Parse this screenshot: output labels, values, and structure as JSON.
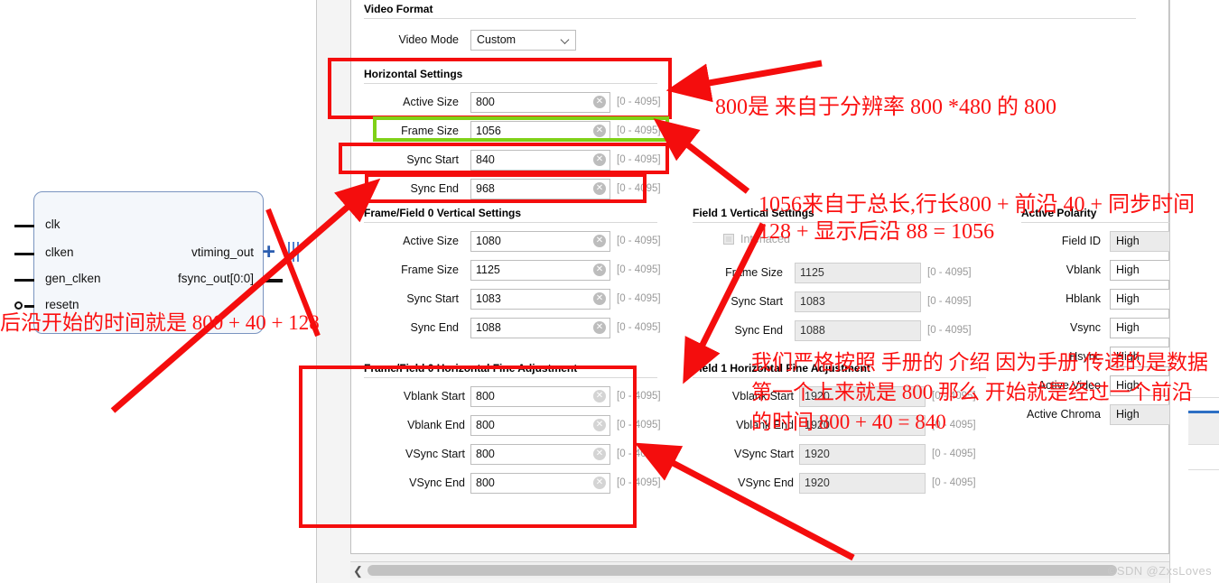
{
  "block_diagram": {
    "inputs": [
      "clk",
      "clken",
      "gen_clken",
      "resetn"
    ],
    "outputs": [
      "vtiming_out",
      "fsync_out[0:0]"
    ]
  },
  "dialog": {
    "video_format": {
      "title": "Video Format",
      "video_mode_label": "Video Mode",
      "video_mode_value": "Custom"
    },
    "horizontal_settings": {
      "title": "Horizontal Settings",
      "range": "[0 - 4095]",
      "rows": [
        {
          "label": "Active Size",
          "value": "800"
        },
        {
          "label": "Frame Size",
          "value": "1056"
        },
        {
          "label": "Sync Start",
          "value": "840"
        },
        {
          "label": "Sync End",
          "value": "968"
        }
      ]
    },
    "frame_field0_vertical": {
      "title": "Frame/Field 0 Vertical Settings",
      "range": "[0 - 4095]",
      "rows": [
        {
          "label": "Active Size",
          "value": "1080"
        },
        {
          "label": "Frame Size",
          "value": "1125"
        },
        {
          "label": "Sync Start",
          "value": "1083"
        },
        {
          "label": "Sync End",
          "value": "1088"
        }
      ]
    },
    "frame_field0_hfine": {
      "title": "Frame/Field 0 Horizontal Fine Adjustment",
      "range": "[0 - 4095]",
      "rows": [
        {
          "label": "Vblank Start",
          "value": "800"
        },
        {
          "label": "Vblank End",
          "value": "800"
        },
        {
          "label": "VSync Start",
          "value": "800"
        },
        {
          "label": "VSync End",
          "value": "800"
        }
      ]
    },
    "field1_vertical": {
      "title": "Field 1 Vertical Settings",
      "interlaced_label": "Interlaced",
      "range": "[0 - 4095]",
      "rows": [
        {
          "label": "Frame Size",
          "value": "1125"
        },
        {
          "label": "Sync Start",
          "value": "1083"
        },
        {
          "label": "Sync End",
          "value": "1088"
        }
      ]
    },
    "field1_hfine": {
      "title": "Field 1 Horizontal Fine Adjustment",
      "range": "[0 - 4095]",
      "rows": [
        {
          "label": "Vblank Start",
          "value": "1920"
        },
        {
          "label": "Vblank End",
          "value": "1920"
        },
        {
          "label": "VSync Start",
          "value": "1920"
        },
        {
          "label": "VSync End",
          "value": "1920"
        }
      ]
    },
    "active_polarity": {
      "title": "Active Polarity",
      "rows": [
        {
          "label": "Field ID",
          "value": "High",
          "disabled": true
        },
        {
          "label": "Vblank",
          "value": "High",
          "disabled": false
        },
        {
          "label": "Hblank",
          "value": "High",
          "disabled": false
        },
        {
          "label": "Vsync",
          "value": "High",
          "disabled": false
        },
        {
          "label": "Hsync",
          "value": "High",
          "disabled": false
        },
        {
          "label": "Active Video",
          "value": "High",
          "disabled": false
        },
        {
          "label": "Active Chroma",
          "value": "High",
          "disabled": true
        }
      ]
    }
  },
  "annotations": {
    "color": "#fb1111",
    "highlight_color": "#7fd117",
    "note_left": "后沿开始的时间就是 800 + 40 + 128",
    "note_800": "800是 来自于分辨率 800 *480 的 800",
    "note_1056_l1": "1056来自于总长,行长800 + 前沿 40 + 同步时间",
    "note_1056_l2": "128 + 显示后沿 88 = 1056",
    "note_manual_l1": "我们严格按照 手册的 介绍 因为手册 传递的是数据",
    "note_manual_l2": "第一个上来就是 800 那么 开始就是经过一个前沿",
    "note_manual_l3": "的时间 800 + 40 = 840"
  },
  "watermark": "©SDN @ZxsLoves"
}
